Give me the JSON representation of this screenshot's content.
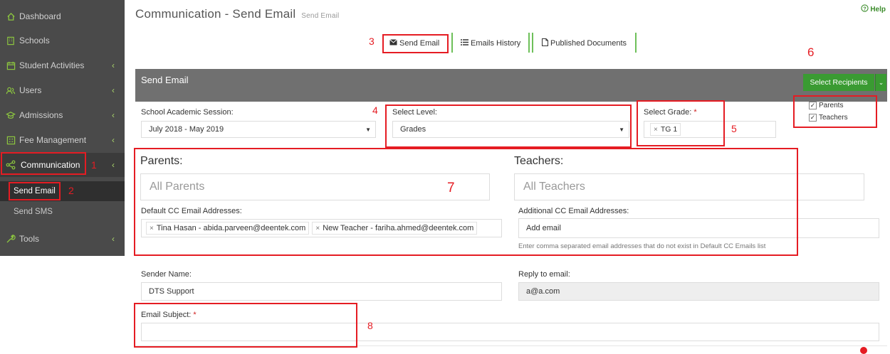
{
  "sidebar": {
    "items": [
      {
        "label": "Dashboard",
        "icon": "home-icon"
      },
      {
        "label": "Schools",
        "icon": "building-icon"
      },
      {
        "label": "Student Activities",
        "icon": "calendar-icon"
      },
      {
        "label": "Users",
        "icon": "users-icon"
      },
      {
        "label": "Admissions",
        "icon": "graduation-cap-icon"
      },
      {
        "label": "Fee Management",
        "icon": "fee-table-icon"
      },
      {
        "label": "Communication",
        "icon": "share-icon"
      },
      {
        "label": "Tools",
        "icon": "wrench-icon"
      }
    ],
    "sub_items": [
      {
        "label": "Send Email"
      },
      {
        "label": "Send SMS"
      }
    ]
  },
  "header": {
    "title": "Communication - Send Email",
    "subtitle": "Send Email",
    "help": "Help"
  },
  "tabs": [
    {
      "label": "Send Email",
      "icon": "envelope-icon"
    },
    {
      "label": "Emails History",
      "icon": "list-icon"
    },
    {
      "label": "Published Documents",
      "icon": "document-icon"
    }
  ],
  "panel": {
    "title": "Send Email",
    "select_recipients": "Select Recipients",
    "recipient_options": [
      {
        "label": "Parents",
        "checked": true
      },
      {
        "label": "Teachers",
        "checked": true
      }
    ]
  },
  "form": {
    "session_label": "School Academic Session:",
    "session_value": "July 2018 - May 2019",
    "level_label": "Select Level:",
    "level_value": "Grades",
    "grade_label": "Select Grade:",
    "grade_tag": "TG 1",
    "parents_heading": "Parents:",
    "parents_placeholder": "All Parents",
    "teachers_heading": "Teachers:",
    "teachers_placeholder": "All Teachers",
    "default_cc_label": "Default CC Email Addresses:",
    "default_cc_tags": [
      "Tina Hasan - abida.parveen@deentek.com",
      "New Teacher - fariha.ahmed@deentek.com"
    ],
    "additional_cc_label": "Additional CC Email Addresses:",
    "additional_cc_placeholder": "Add email",
    "additional_cc_hint": "Enter comma separated email addresses that do not exist in Default CC Emails list",
    "sender_name_label": "Sender Name:",
    "sender_name_value": "DTS Support",
    "reply_to_label": "Reply to email:",
    "reply_to_value": "a@a.com",
    "subject_label": "Email Subject:",
    "required_mark": "*"
  },
  "annotations": [
    "1",
    "2",
    "3",
    "4",
    "5",
    "6",
    "7",
    "8"
  ],
  "colors": {
    "sidebar_bg": "#4a4a4a",
    "accent_green": "#3a9b32",
    "annotation_red": "#e51c23",
    "panel_header": "#707070"
  }
}
